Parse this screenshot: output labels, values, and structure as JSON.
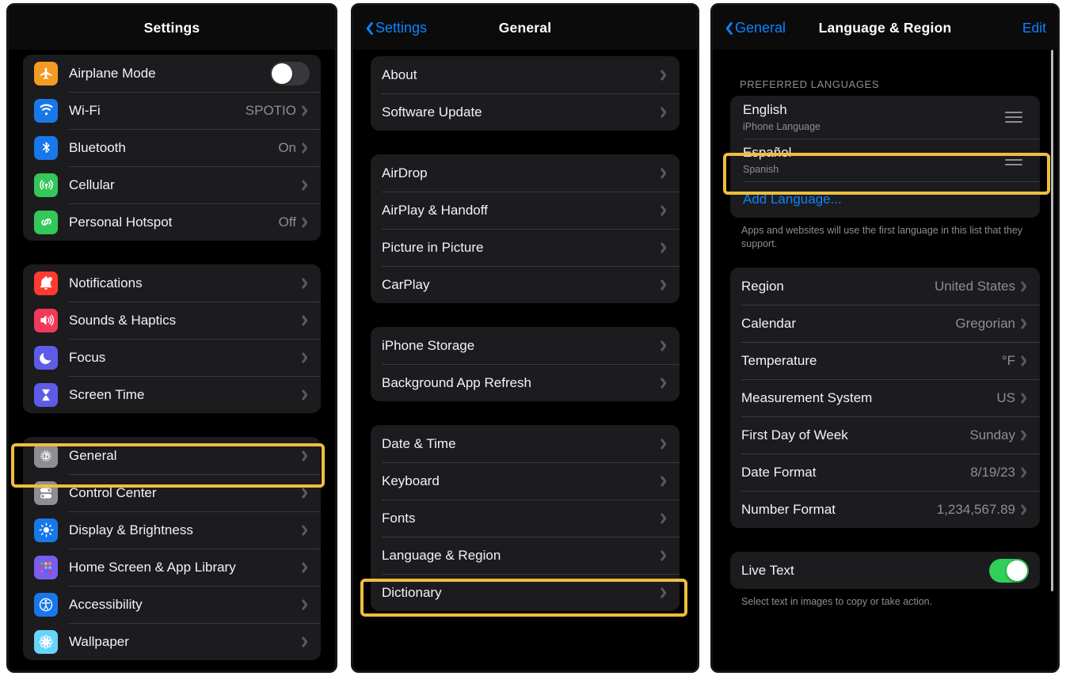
{
  "panels": {
    "settings": {
      "title": "Settings",
      "groups": [
        {
          "rows": [
            {
              "label": "Airplane Mode",
              "icon": "airplane-icon",
              "control": "toggle",
              "toggle_on": false
            },
            {
              "label": "Wi-Fi",
              "icon": "wifi-icon",
              "value": "SPOTIO",
              "control": "chevron"
            },
            {
              "label": "Bluetooth",
              "icon": "bluetooth-icon",
              "value": "On",
              "control": "chevron"
            },
            {
              "label": "Cellular",
              "icon": "cellular-icon",
              "value": "",
              "control": "chevron"
            },
            {
              "label": "Personal Hotspot",
              "icon": "hotspot-icon",
              "value": "Off",
              "control": "chevron"
            }
          ]
        },
        {
          "rows": [
            {
              "label": "Notifications",
              "icon": "notifications-icon",
              "value": "",
              "control": "chevron"
            },
            {
              "label": "Sounds & Haptics",
              "icon": "sounds-icon",
              "value": "",
              "control": "chevron"
            },
            {
              "label": "Focus",
              "icon": "focus-icon",
              "value": "",
              "control": "chevron"
            },
            {
              "label": "Screen Time",
              "icon": "screentime-icon",
              "value": "",
              "control": "chevron"
            }
          ]
        },
        {
          "rows": [
            {
              "label": "General",
              "icon": "gear-icon",
              "value": "",
              "control": "chevron",
              "highlighted": true
            },
            {
              "label": "Control Center",
              "icon": "control-center-icon",
              "value": "",
              "control": "chevron"
            },
            {
              "label": "Display & Brightness",
              "icon": "brightness-icon",
              "value": "",
              "control": "chevron"
            },
            {
              "label": "Home Screen & App Library",
              "icon": "home-screen-icon",
              "value": "",
              "control": "chevron"
            },
            {
              "label": "Accessibility",
              "icon": "accessibility-icon",
              "value": "",
              "control": "chevron"
            },
            {
              "label": "Wallpaper",
              "icon": "wallpaper-icon",
              "value": "",
              "control": "chevron"
            }
          ]
        }
      ]
    },
    "general": {
      "back_label": "Settings",
      "title": "General",
      "groups": [
        {
          "rows": [
            {
              "label": "About"
            },
            {
              "label": "Software Update"
            }
          ]
        },
        {
          "rows": [
            {
              "label": "AirDrop"
            },
            {
              "label": "AirPlay & Handoff"
            },
            {
              "label": "Picture in Picture"
            },
            {
              "label": "CarPlay"
            }
          ]
        },
        {
          "rows": [
            {
              "label": "iPhone Storage"
            },
            {
              "label": "Background App Refresh"
            }
          ]
        },
        {
          "rows": [
            {
              "label": "Date & Time"
            },
            {
              "label": "Keyboard"
            },
            {
              "label": "Fonts"
            },
            {
              "label": "Language & Region",
              "highlighted": true
            },
            {
              "label": "Dictionary"
            }
          ]
        }
      ]
    },
    "language_region": {
      "back_label": "General",
      "title": "Language & Region",
      "edit_label": "Edit",
      "section_header": "PREFERRED LANGUAGES",
      "languages": [
        {
          "name": "English",
          "sub": "iPhone Language"
        },
        {
          "name": "Español",
          "sub": "Spanish",
          "highlighted": true
        }
      ],
      "add_language_label": "Add Language...",
      "languages_footer": "Apps and websites will use the first language in this list that they support.",
      "region_rows": [
        {
          "label": "Region",
          "value": "United States"
        },
        {
          "label": "Calendar",
          "value": "Gregorian"
        },
        {
          "label": "Temperature",
          "value": "°F"
        },
        {
          "label": "Measurement System",
          "value": "US"
        },
        {
          "label": "First Day of Week",
          "value": "Sunday"
        },
        {
          "label": "Date Format",
          "value": "8/19/23"
        },
        {
          "label": "Number Format",
          "value": "1,234,567.89"
        }
      ],
      "live_text": {
        "label": "Live Text",
        "toggle_on": true
      },
      "live_text_footer": "Select text in images to copy or take action."
    }
  },
  "colors": {
    "highlight": "#eebe3e",
    "accent_blue": "#0a84ff",
    "toggle_on": "#30d158",
    "group_bg": "#1c1c1e",
    "page_bg": "#000000",
    "secondary_text": "#8e8e93"
  }
}
